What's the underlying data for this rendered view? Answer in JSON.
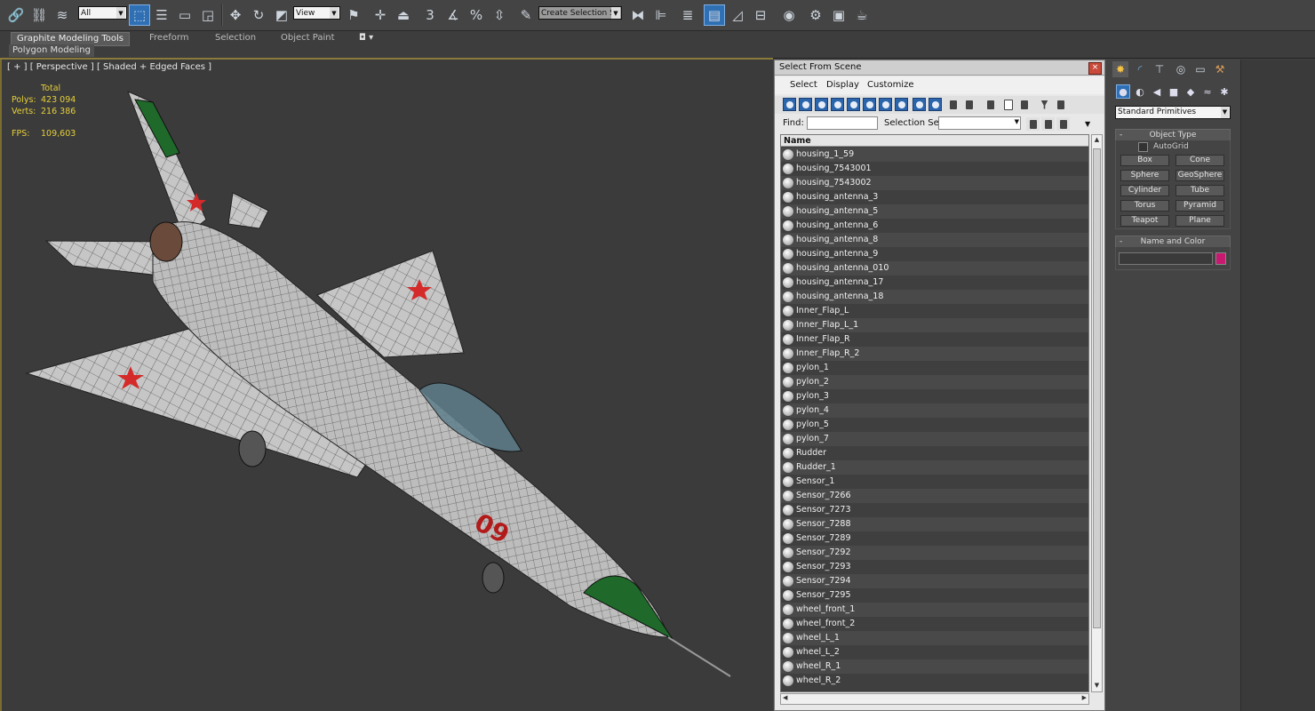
{
  "toolbar": {
    "selection_filter": "All",
    "ref_coord": "View",
    "named_selection_placeholder": "Create Selection Se",
    "snap_label": "3",
    "percent_snap": "%"
  },
  "ribbon": {
    "tabs": [
      "Graphite Modeling Tools",
      "Freeform",
      "Selection",
      "Object Paint"
    ],
    "panel": "Polygon Modeling"
  },
  "viewport": {
    "label": "[ + ] [ Perspective ] [ Shaded + Edged Faces ]",
    "stats": {
      "total_label": "Total",
      "polys_label": "Polys:",
      "polys_value": "423 094",
      "verts_label": "Verts:",
      "verts_value": "216 386",
      "fps_label": "FPS:",
      "fps_value": "109,603"
    },
    "aircraft_numbers": "09",
    "colors": {
      "background": "#3b3b3b",
      "fuselage": "#c9c9c9",
      "wire": "#1a1a1a",
      "star": "#d42a2a",
      "nose": "#1f6a2a"
    }
  },
  "dialog": {
    "title": "Select From Scene",
    "close": "×",
    "menu": [
      "Select",
      "Display",
      "Customize"
    ],
    "find_label": "Find:",
    "selection_set_label": "Selection Set:",
    "column_header": "Name",
    "items": [
      "housing_1_59",
      "housing_7543001",
      "housing_7543002",
      "housing_antenna_3",
      "housing_antenna_5",
      "housing_antenna_6",
      "housing_antenna_8",
      "housing_antenna_9",
      "housing_antenna_010",
      "housing_antenna_17",
      "housing_antenna_18",
      "Inner_Flap_L",
      "Inner_Flap_L_1",
      "Inner_Flap_R",
      "Inner_Flap_R_2",
      "pylon_1",
      "pylon_2",
      "pylon_3",
      "pylon_4",
      "pylon_5",
      "pylon_7",
      "Rudder",
      "Rudder_1",
      "Sensor_1",
      "Sensor_7266",
      "Sensor_7273",
      "Sensor_7288",
      "Sensor_7289",
      "Sensor_7292",
      "Sensor_7293",
      "Sensor_7294",
      "Sensor_7295",
      "wheel_front_1",
      "wheel_front_2",
      "wheel_L_1",
      "wheel_L_2",
      "wheel_R_1",
      "wheel_R_2"
    ]
  },
  "command_panel": {
    "category": "Standard Primitives",
    "object_type_title": "Object Type",
    "autogrid": "AutoGrid",
    "primitives": [
      "Box",
      "Cone",
      "Sphere",
      "GeoSphere",
      "Cylinder",
      "Tube",
      "Torus",
      "Pyramid",
      "Teapot",
      "Plane"
    ],
    "name_color_title": "Name and Color",
    "rollout_minus": "-",
    "swatch_color": "#c8186f"
  }
}
